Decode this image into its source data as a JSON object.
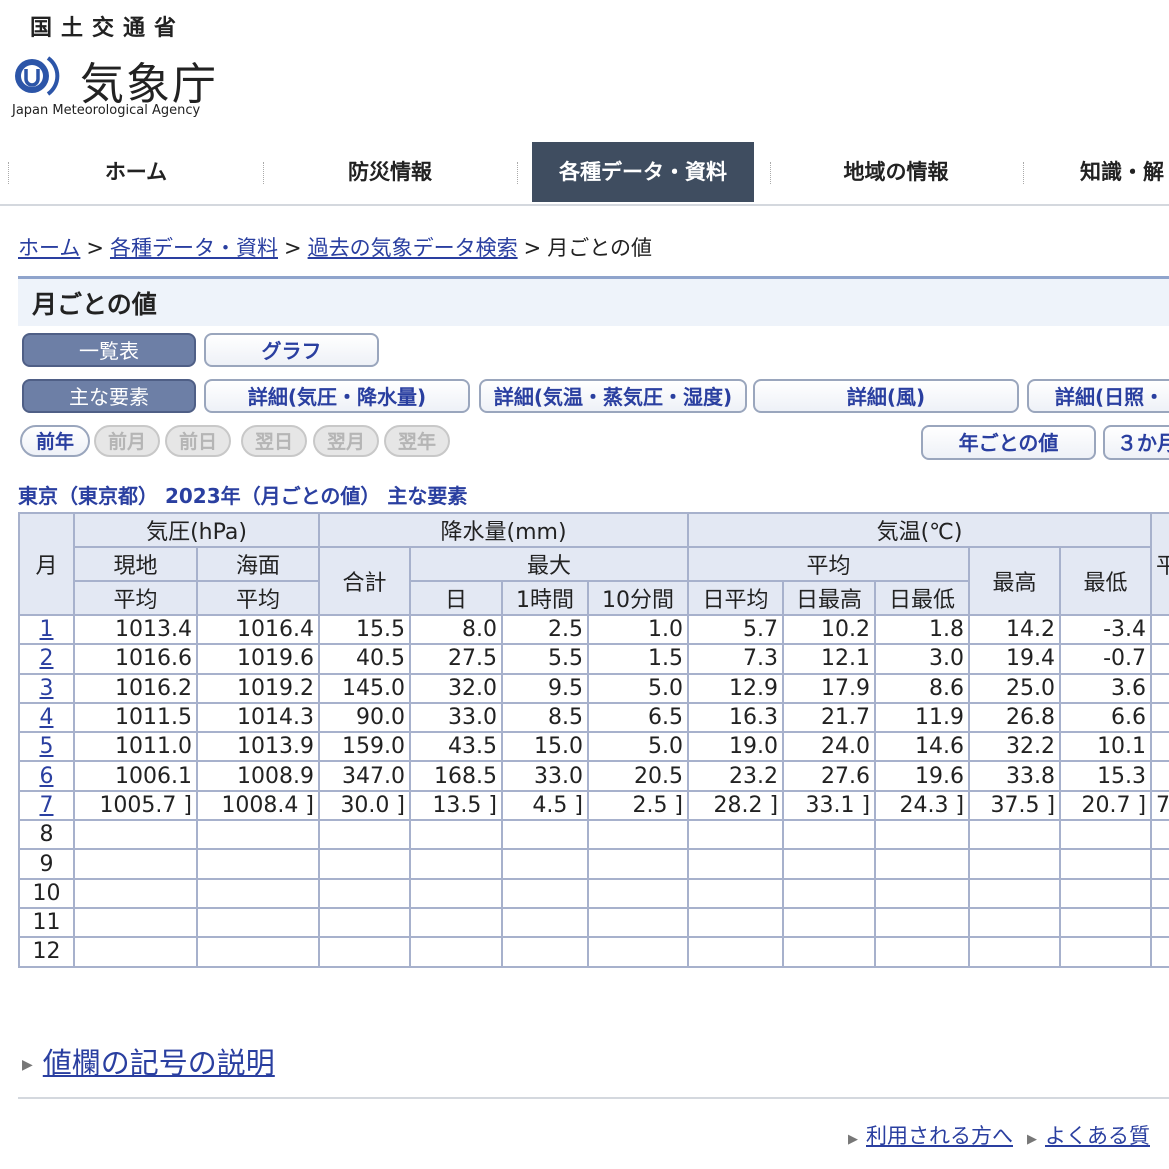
{
  "header": {
    "ministry": "国土交通省",
    "agency": "気象庁",
    "agency_en": "Japan Meteorological Agency"
  },
  "nav": {
    "items": [
      "ホーム",
      "防災情報",
      "各種データ・資料",
      "地域の情報",
      "知識・解"
    ],
    "active_index": 2
  },
  "breadcrumb": {
    "items": [
      "ホーム",
      "各種データ・資料",
      "過去の気象データ検索"
    ],
    "current": "月ごとの値",
    "sep": ">"
  },
  "page_title": "月ごとの値",
  "view_tabs": {
    "list": "一覧表",
    "graph": "グラフ"
  },
  "element_tabs": {
    "main": "主な要素",
    "pressure_precip": "詳細(気圧・降水量)",
    "temp": "詳細(気温・蒸気圧・湿度)",
    "wind": "詳細(風)",
    "sun": "詳細(日照・"
  },
  "period_nav": {
    "prev_year": "前年",
    "prev_month": "前月",
    "prev_day": "前日",
    "next_day": "翌日",
    "next_month": "翌月",
    "next_year": "翌年",
    "yearly": "年ごとの値",
    "three_month": "３か月"
  },
  "caption": "東京（東京都） 2023年（月ごとの値） 主な要素",
  "table": {
    "headers": {
      "month": "月",
      "pressure": "気圧(hPa)",
      "precip": "降水量(mm)",
      "temp": "気温(℃)",
      "station": "現地",
      "sea": "海面",
      "mean": "平均",
      "total": "合計",
      "max": "最大",
      "day": "日",
      "hour": "1時間",
      "min10": "10分間",
      "daily_mean": "日平均",
      "daily_max": "日最高",
      "daily_min": "日最低",
      "highest": "最高",
      "lowest": "最低",
      "next_cut": "平"
    },
    "rows": [
      {
        "month": "1",
        "vals": [
          "1013.4",
          "1016.4",
          "15.5",
          "8.0",
          "2.5",
          "1.0",
          "5.7",
          "10.2",
          "1.8",
          "14.2",
          "-3.4",
          ""
        ]
      },
      {
        "month": "2",
        "vals": [
          "1016.6",
          "1019.6",
          "40.5",
          "27.5",
          "5.5",
          "1.5",
          "7.3",
          "12.1",
          "3.0",
          "19.4",
          "-0.7",
          ""
        ]
      },
      {
        "month": "3",
        "vals": [
          "1016.2",
          "1019.2",
          "145.0",
          "32.0",
          "9.5",
          "5.0",
          "12.9",
          "17.9",
          "8.6",
          "25.0",
          "3.6",
          ""
        ]
      },
      {
        "month": "4",
        "vals": [
          "1011.5",
          "1014.3",
          "90.0",
          "33.0",
          "8.5",
          "6.5",
          "16.3",
          "21.7",
          "11.9",
          "26.8",
          "6.6",
          ""
        ]
      },
      {
        "month": "5",
        "vals": [
          "1011.0",
          "1013.9",
          "159.0",
          "43.5",
          "15.0",
          "5.0",
          "19.0",
          "24.0",
          "14.6",
          "32.2",
          "10.1",
          ""
        ]
      },
      {
        "month": "6",
        "vals": [
          "1006.1",
          "1008.9",
          "347.0",
          "168.5",
          "33.0",
          "20.5",
          "23.2",
          "27.6",
          "19.6",
          "33.8",
          "15.3",
          ""
        ]
      },
      {
        "month": "7",
        "vals": [
          "1005.7 ]",
          "1008.4 ]",
          "30.0 ]",
          "13.5 ]",
          "4.5 ]",
          "2.5 ]",
          "28.2 ]",
          "33.1 ]",
          "24.3 ]",
          "37.5 ]",
          "20.7 ]",
          "7"
        ]
      },
      {
        "month": "8",
        "vals": [
          "",
          "",
          "",
          "",
          "",
          "",
          "",
          "",
          "",
          "",
          "",
          ""
        ]
      },
      {
        "month": "9",
        "vals": [
          "",
          "",
          "",
          "",
          "",
          "",
          "",
          "",
          "",
          "",
          "",
          ""
        ]
      },
      {
        "month": "10",
        "vals": [
          "",
          "",
          "",
          "",
          "",
          "",
          "",
          "",
          "",
          "",
          "",
          ""
        ]
      },
      {
        "month": "11",
        "vals": [
          "",
          "",
          "",
          "",
          "",
          "",
          "",
          "",
          "",
          "",
          "",
          ""
        ]
      },
      {
        "month": "12",
        "vals": [
          "",
          "",
          "",
          "",
          "",
          "",
          "",
          "",
          "",
          "",
          "",
          ""
        ]
      }
    ],
    "linked_months": 7
  },
  "legend_link": "値欄の記号の説明",
  "footer": {
    "users": "利用される方へ",
    "faq": "よくある質"
  },
  "colors": {
    "nav_active": "#3f4d60",
    "link": "#2a3fa0",
    "table_border": "#a7b1cc",
    "header_bg": "#e3e8f3"
  }
}
